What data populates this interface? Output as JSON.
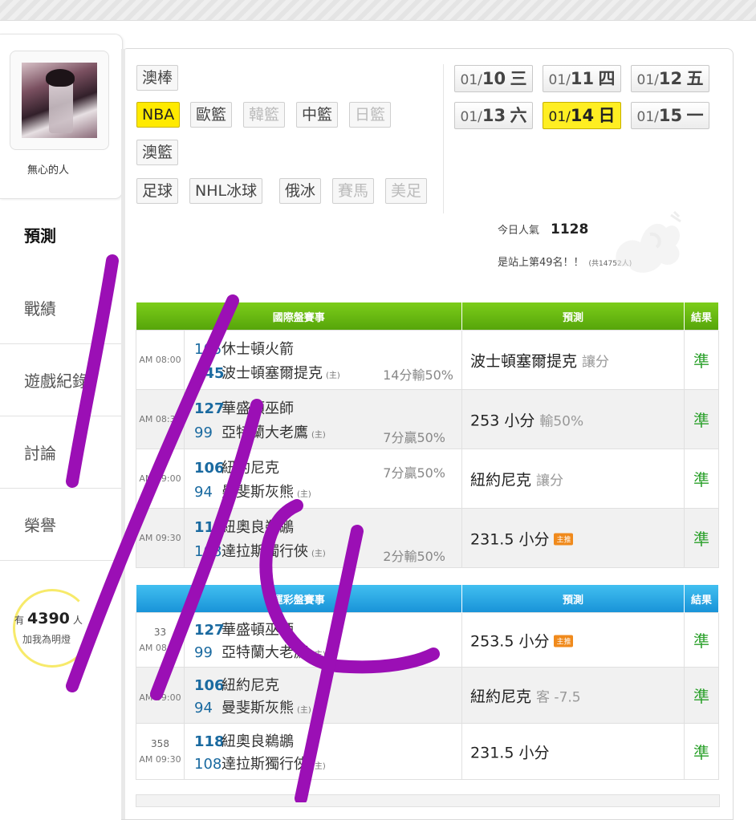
{
  "user": {
    "name": "無心的人"
  },
  "sidebar": {
    "items": [
      {
        "label": "預測",
        "active": true
      },
      {
        "label": "戰績"
      },
      {
        "label": "遊戲紀錄"
      },
      {
        "label": "討論"
      },
      {
        "label": "榮譽"
      }
    ]
  },
  "fans": {
    "prefix": "有",
    "count": "4390",
    "suffix": "人",
    "action": "加我為明燈"
  },
  "sports": [
    {
      "label": "澳棒",
      "state": "normal"
    },
    {
      "label": "NBA",
      "state": "selected"
    },
    {
      "label": "歐籃",
      "state": "normal"
    },
    {
      "label": "韓籃",
      "state": "disabled"
    },
    {
      "label": "中籃",
      "state": "normal"
    },
    {
      "label": "日籃",
      "state": "disabled"
    },
    {
      "label": "澳籃",
      "state": "normal"
    },
    {
      "label": "足球",
      "state": "normal"
    },
    {
      "label": "NHL冰球",
      "state": "normal"
    },
    {
      "label": "俄冰",
      "state": "normal"
    },
    {
      "label": "賽馬",
      "state": "disabled"
    },
    {
      "label": "美足",
      "state": "disabled"
    }
  ],
  "dates": [
    {
      "md": "01/",
      "d": "10",
      "wd": "三"
    },
    {
      "md": "01/",
      "d": "11",
      "wd": "四"
    },
    {
      "md": "01/",
      "d": "12",
      "wd": "五"
    },
    {
      "md": "01/",
      "d": "13",
      "wd": "六"
    },
    {
      "md": "01/",
      "d": "14",
      "wd": "日",
      "selected": true
    },
    {
      "md": "01/",
      "d": "15",
      "wd": "一"
    }
  ],
  "stats": {
    "popularity_label": "今日人氣",
    "popularity_value": "1128",
    "rank_text": "是站上第49名！！",
    "rank_total": "(共14752人)"
  },
  "intl": {
    "headers": [
      "國際盤賽事",
      "預測",
      "結果"
    ],
    "games": [
      {
        "num": "",
        "time": "AM 08:00",
        "s1": "105",
        "t1": "休士頓火箭",
        "s2": "145",
        "t2": "波士頓塞爾提克",
        "home": "(主)",
        "hc": "14分輸50%",
        "hc_row": 2,
        "pred": "波士頓塞爾提克",
        "pred_sub": "讓分",
        "badge": "",
        "result": "準",
        "winner": 2
      },
      {
        "num": "",
        "time": "AM 08:30",
        "s1": "127",
        "t1": "華盛頓巫師",
        "s2": "99",
        "t2": "亞特蘭大老鷹",
        "home": "(主)",
        "hc": "7分贏50%",
        "hc_row": 2,
        "pred": "253 小分",
        "pred_sub": "輸50%",
        "badge": "",
        "result": "準",
        "winner": 1
      },
      {
        "num": "",
        "time": "AM 09:00",
        "s1": "106",
        "t1": "紐約尼克",
        "s2": "94",
        "t2": "曼斐斯灰熊",
        "home": "(主)",
        "hc": "7分贏50%",
        "hc_row": 1,
        "pred": "紐約尼克",
        "pred_sub": "讓分",
        "badge": "",
        "result": "準",
        "winner": 1
      },
      {
        "num": "",
        "time": "AM 09:30",
        "s1": "118",
        "t1": "紐奧良鵜鶘",
        "s2": "108",
        "t2": "達拉斯獨行俠",
        "home": "(主)",
        "hc": "2分輸50%",
        "hc_row": 2,
        "pred": "231.5 小分",
        "pred_sub": "",
        "badge": "主推",
        "result": "準",
        "winner": 1
      }
    ]
  },
  "sport_lottery": {
    "headers": [
      "運彩盤賽事",
      "預測",
      "結果"
    ],
    "games": [
      {
        "num": "33",
        "time": "AM 08:30",
        "s1": "127",
        "t1": "華盛頓巫師",
        "s2": "99",
        "t2": "亞特蘭大老鷹",
        "home": "(主)",
        "hc": "",
        "pred": "253.5 小分",
        "pred_sub": "",
        "badge": "主推",
        "result": "準",
        "winner": 1
      },
      {
        "num": "",
        "time": "AM 09:00",
        "s1": "106",
        "t1": "紐約尼克",
        "s2": "94",
        "t2": "曼斐斯灰熊",
        "home": "(主)",
        "hc": "",
        "pred": "紐約尼克",
        "pred_sub": "客 -7.5",
        "badge": "",
        "result": "準",
        "winner": 1
      },
      {
        "num": "358",
        "time": "AM 09:30",
        "s1": "118",
        "t1": "紐奧良鵜鶘",
        "s2": "108",
        "t2": "達拉斯獨行俠",
        "home": "(主)",
        "hc": "",
        "pred": "231.5 小分",
        "pred_sub": "",
        "badge": "",
        "result": "準",
        "winner": 1
      }
    ]
  },
  "colors": {
    "selected": "#ffea00",
    "intl_header": "#6cbd14",
    "lottery_header": "#2aa8e6",
    "result": "#2aa02a",
    "annotation": "#9b0fb5"
  }
}
